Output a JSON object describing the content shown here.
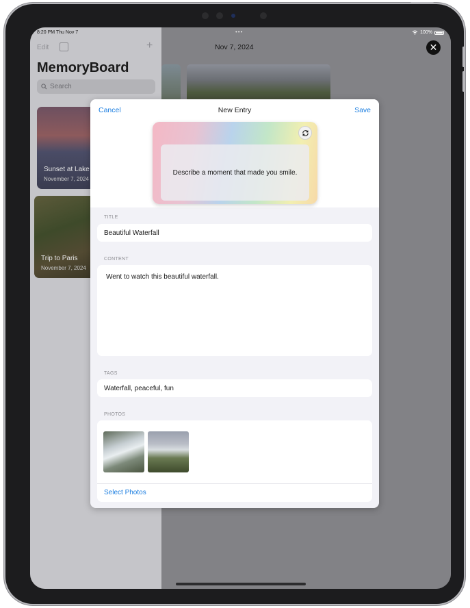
{
  "status_bar": {
    "time": "8:20 PM  Thu Nov 7",
    "battery": "100%"
  },
  "sidebar": {
    "edit_label": "Edit",
    "title": "MemoryBoard",
    "search_placeholder": "Search",
    "entries": [
      {
        "title": "Sunset at Lake",
        "date": "November 7, 2024"
      },
      {
        "title": "Trip to Paris",
        "date": "November 7, 2024"
      }
    ]
  },
  "main": {
    "date": "Nov 7, 2024"
  },
  "modal": {
    "cancel_label": "Cancel",
    "title": "New Entry",
    "save_label": "Save",
    "prompt": "Describe a moment that made you smile.",
    "title_label": "TITLE",
    "title_value": "Beautiful Waterfall",
    "content_label": "CONTENT",
    "content_value": "Went to watch this beautiful waterfall.",
    "tags_label": "TAGS",
    "tags_value": "Waterfall, peaceful, fun",
    "photos_label": "PHOTOS",
    "select_photos_label": "Select Photos"
  },
  "colors": {
    "accent": "#1a7de0"
  }
}
